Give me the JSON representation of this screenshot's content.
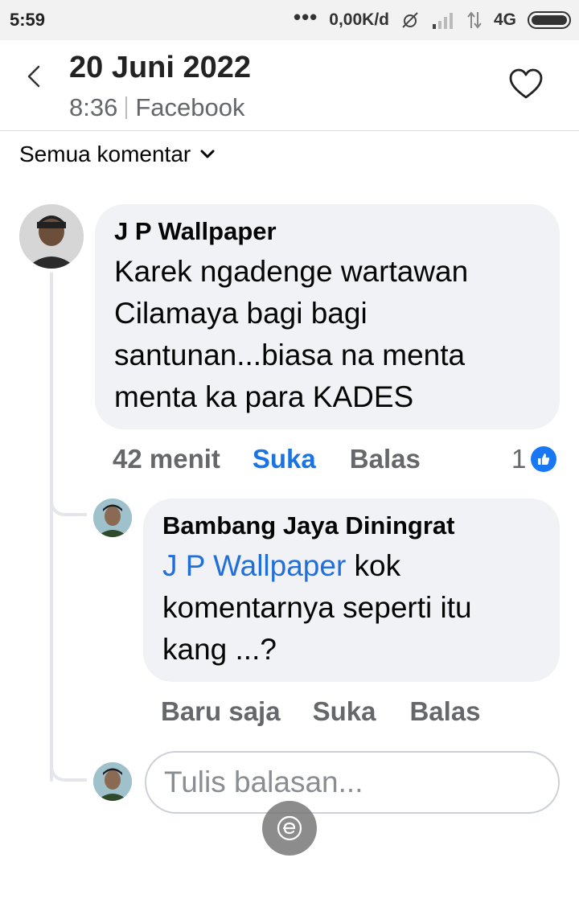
{
  "status_bar": {
    "time": "5:59",
    "more": "•••",
    "speed": "0,00K/d",
    "network": "4G"
  },
  "header": {
    "title": "20 Juni 2022",
    "time": "8:36",
    "source": "Facebook"
  },
  "filter": {
    "label": "Semua komentar"
  },
  "comment": {
    "author": "J P Wallpaper",
    "text": "Karek ngadenge wartawan Cilamaya bagi bagi santunan...biasa na menta menta ka para KADES",
    "time": "42 menit",
    "like_label": "Suka",
    "reply_label": "Balas",
    "reaction_count": "1"
  },
  "reply": {
    "author": "Bambang Jaya Diningrat",
    "mention": "J P Wallpaper",
    "text": " kok komentarnya seperti itu kang ...?",
    "time": "Baru saja",
    "like_label": "Suka",
    "reply_label": "Balas"
  },
  "composer": {
    "placeholder": "Tulis balasan..."
  },
  "colors": {
    "accent": "#1b74e4",
    "mention": "#216fdb",
    "bubble": "#f0f2f5",
    "muted": "#65676b"
  }
}
